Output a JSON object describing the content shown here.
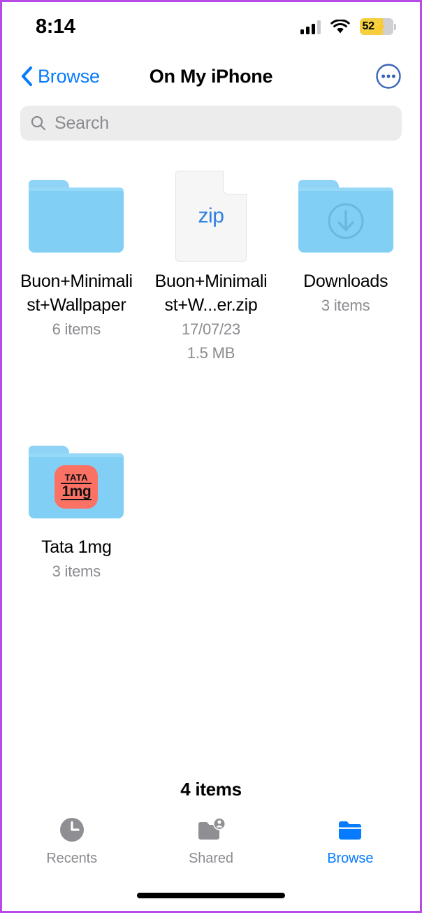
{
  "status_bar": {
    "time": "8:14",
    "cellular_icon": "cellular-bars-icon",
    "wifi_icon": "wifi-icon",
    "battery_percent": "52",
    "battery_charging_glyph": "⚡",
    "battery_color": "#f5cf3d"
  },
  "nav_bar": {
    "back_label": "Browse",
    "back_icon": "chevron-left-icon",
    "title": "On My iPhone",
    "more_icon": "ellipsis-circle-icon",
    "accent_color": "#067bff"
  },
  "search": {
    "placeholder": "Search",
    "icon": "search-icon"
  },
  "files": [
    {
      "name": "Buon+Minimalist+Wallpaper",
      "icon": "folder-icon",
      "meta1": "6 items",
      "meta2": ""
    },
    {
      "name": "Buon+Minimalist+W...er.zip",
      "icon": "zip-document-icon",
      "ext_label": "zip",
      "meta1": "17/07/23",
      "meta2": "1.5 MB"
    },
    {
      "name": "Downloads",
      "icon": "folder-downloads-icon",
      "meta1": "3 items",
      "meta2": ""
    },
    {
      "name": "Tata 1mg",
      "icon": "folder-app-badge-icon",
      "badge_line1": "TATA",
      "badge_line2": "1mg",
      "badge_color": "#fb7265",
      "meta1": "3 items",
      "meta2": ""
    }
  ],
  "footer": {
    "item_count": "4 items"
  },
  "tab_bar": {
    "tabs": [
      {
        "label": "Recents",
        "icon": "clock-icon",
        "active": false
      },
      {
        "label": "Shared",
        "icon": "folder-person-icon",
        "active": false
      },
      {
        "label": "Browse",
        "icon": "folder-filled-icon",
        "active": true
      }
    ]
  },
  "colors": {
    "folder_blue": "#82cff5",
    "ios_blue": "#067bff",
    "secondary_text": "#8b8b90",
    "search_bg": "#ececed"
  }
}
